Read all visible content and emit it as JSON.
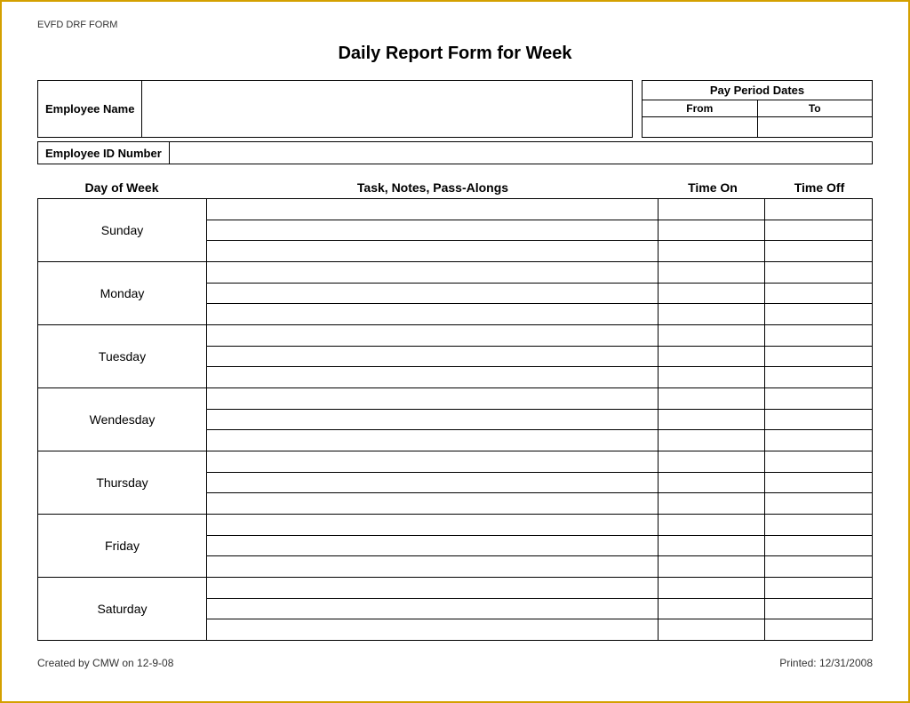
{
  "header": {
    "form_label": "EVFD DRF FORM",
    "title": "Daily Report Form for Week"
  },
  "fields": {
    "employee_name_label": "Employee Name",
    "employee_id_label": "Employee ID Number",
    "pay_period_label": "Pay Period Dates",
    "pay_period_from": "From",
    "pay_period_to": "To"
  },
  "columns": {
    "day_of_week": "Day of Week",
    "tasks": "Task, Notes, Pass-Alongs",
    "time_on": "Time On",
    "time_off": "Time Off"
  },
  "days": [
    "Sunday",
    "Monday",
    "Tuesday",
    "Wendesday",
    "Thursday",
    "Friday",
    "Saturday"
  ],
  "footer": {
    "created": "Created by CMW on 12-9-08",
    "printed": "Printed: 12/31/2008"
  }
}
